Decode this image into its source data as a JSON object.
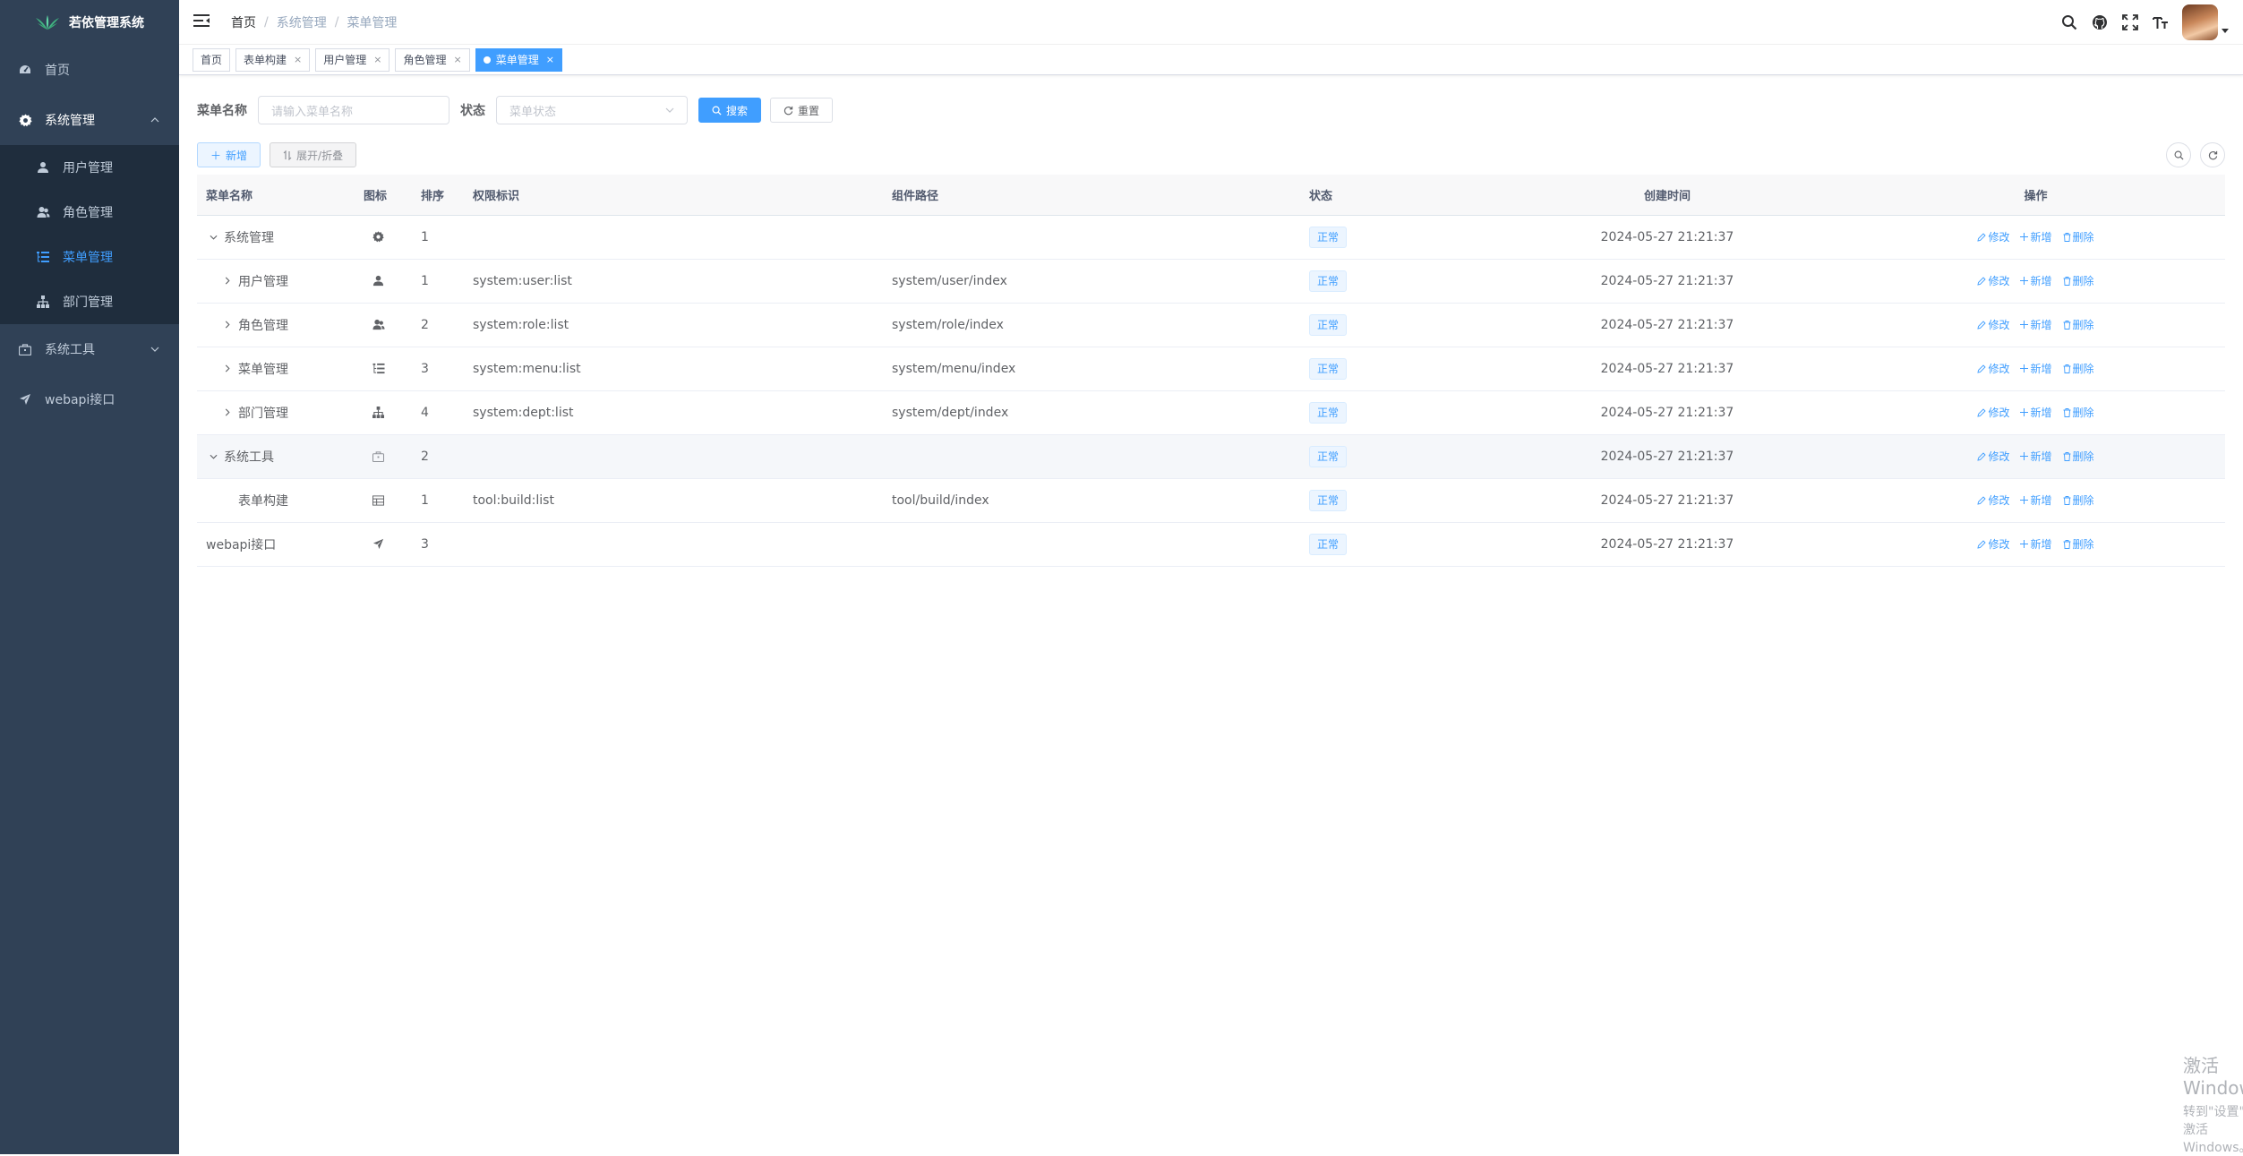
{
  "app": {
    "title": "若依管理系统"
  },
  "sidebar": {
    "items": [
      {
        "label": "首页",
        "icon": "dashboard-icon"
      },
      {
        "label": "系统管理",
        "icon": "gear-icon",
        "children": [
          {
            "label": "用户管理",
            "icon": "user-icon"
          },
          {
            "label": "角色管理",
            "icon": "peoples-icon"
          },
          {
            "label": "菜单管理",
            "icon": "tree-table-icon"
          },
          {
            "label": "部门管理",
            "icon": "tree-icon"
          }
        ]
      },
      {
        "label": "系统工具",
        "icon": "toolbox-icon"
      },
      {
        "label": "webapi接口",
        "icon": "send-icon"
      }
    ]
  },
  "breadcrumb": [
    "首页",
    "系统管理",
    "菜单管理"
  ],
  "tags": [
    {
      "label": "首页",
      "closable": false
    },
    {
      "label": "表单构建",
      "closable": true
    },
    {
      "label": "用户管理",
      "closable": true
    },
    {
      "label": "角色管理",
      "closable": true
    },
    {
      "label": "菜单管理",
      "closable": true,
      "active": true
    }
  ],
  "search": {
    "name_label": "菜单名称",
    "name_placeholder": "请输入菜单名称",
    "status_label": "状态",
    "status_placeholder": "菜单状态",
    "search_btn": "搜索",
    "reset_btn": "重置"
  },
  "toolbar": {
    "add_btn": "新增",
    "toggle_btn": "展开/折叠"
  },
  "table": {
    "columns": [
      "菜单名称",
      "图标",
      "排序",
      "权限标识",
      "组件路径",
      "状态",
      "创建时间",
      "操作"
    ],
    "rows": [
      {
        "name": "系统管理",
        "icon": "gear-icon",
        "order": "1",
        "perm": "",
        "component": "",
        "status": "正常",
        "time": "2024-05-27 21:21:37"
      },
      {
        "name": "用户管理",
        "icon": "user-icon",
        "order": "1",
        "perm": "system:user:list",
        "component": "system/user/index",
        "status": "正常",
        "time": "2024-05-27 21:21:37"
      },
      {
        "name": "角色管理",
        "icon": "peoples-icon",
        "order": "2",
        "perm": "system:role:list",
        "component": "system/role/index",
        "status": "正常",
        "time": "2024-05-27 21:21:37"
      },
      {
        "name": "菜单管理",
        "icon": "tree-table-icon",
        "order": "3",
        "perm": "system:menu:list",
        "component": "system/menu/index",
        "status": "正常",
        "time": "2024-05-27 21:21:37"
      },
      {
        "name": "部门管理",
        "icon": "tree-icon",
        "order": "4",
        "perm": "system:dept:list",
        "component": "system/dept/index",
        "status": "正常",
        "time": "2024-05-27 21:21:37"
      },
      {
        "name": "系统工具",
        "icon": "toolbox-icon",
        "order": "2",
        "perm": "",
        "component": "",
        "status": "正常",
        "time": "2024-05-27 21:21:37"
      },
      {
        "name": "表单构建",
        "icon": "build-icon",
        "order": "1",
        "perm": "tool:build:list",
        "component": "tool/build/index",
        "status": "正常",
        "time": "2024-05-27 21:21:37"
      },
      {
        "name": "webapi接口",
        "icon": "send-icon",
        "order": "3",
        "perm": "",
        "component": "",
        "status": "正常",
        "time": "2024-05-27 21:21:37"
      }
    ],
    "ops": {
      "edit": "修改",
      "add": "新增",
      "delete": "删除"
    }
  },
  "watermark": {
    "line1": "激活 Windows",
    "line2": "转到\"设置\"以激活 Windows。"
  },
  "colors": {
    "sidebar_bg": "#304156",
    "sidebar_sub_bg": "#1f2d3d",
    "primary": "#409eff"
  }
}
